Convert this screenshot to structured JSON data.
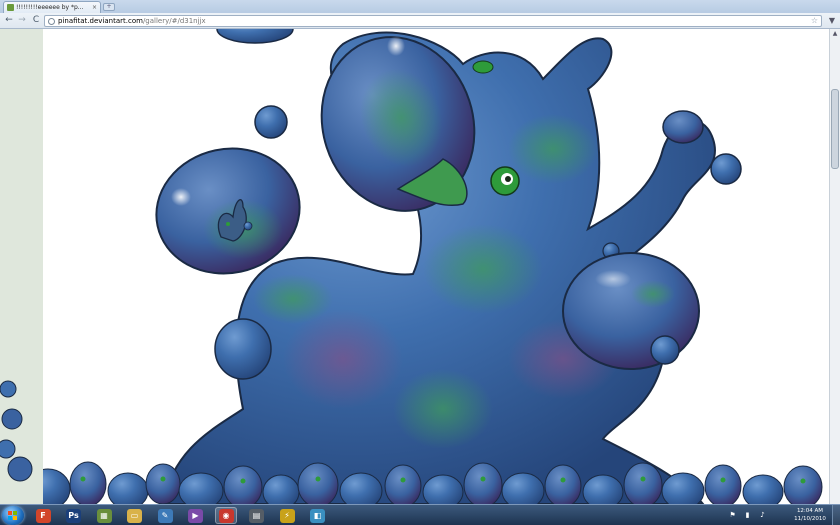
{
  "browser": {
    "tab_title": "!!!!!!!!!eeeeee by *p...",
    "tab_close": "×",
    "new_tab": "+",
    "address": {
      "host": "pinafitat.deviantart.com",
      "path": "/gallery/#/d31njjx"
    },
    "nav": {
      "back": "←",
      "forward": "→",
      "reload": "C"
    },
    "bookmark_star": "☆",
    "page_menu": "▼"
  },
  "scrollbar": {
    "up_arrow": "▲"
  },
  "taskbar": {
    "icons": [
      {
        "name": "firefox-icon",
        "glyph": "F",
        "color": "#d2452a"
      },
      {
        "name": "photoshop-icon",
        "glyph": "Ps",
        "color": "#1b3f7a"
      },
      {
        "name": "photo-viewer-icon",
        "glyph": "▦",
        "color": "#6a8f3c"
      },
      {
        "name": "folder-icon",
        "glyph": "▭",
        "color": "#d9b24a"
      },
      {
        "name": "paint-icon",
        "glyph": "✎",
        "color": "#3d7ab8"
      },
      {
        "name": "media-player-icon",
        "glyph": "▶",
        "color": "#7a4aa8"
      },
      {
        "name": "chrome-icon",
        "glyph": "◉",
        "color": "#c8372d"
      },
      {
        "name": "calculator-icon",
        "glyph": "▤",
        "color": "#555d66"
      },
      {
        "name": "winamp-icon",
        "glyph": "⚡",
        "color": "#c8a21a"
      },
      {
        "name": "screenshot-icon",
        "glyph": "◧",
        "color": "#3a8fc0"
      }
    ],
    "tray": [
      {
        "name": "flag-icon",
        "glyph": "⚑"
      },
      {
        "name": "network-icon",
        "glyph": "▮"
      },
      {
        "name": "volume-icon",
        "glyph": "♪"
      }
    ],
    "clock_time": "12:04 AM",
    "clock_date": "11/10/2010"
  }
}
